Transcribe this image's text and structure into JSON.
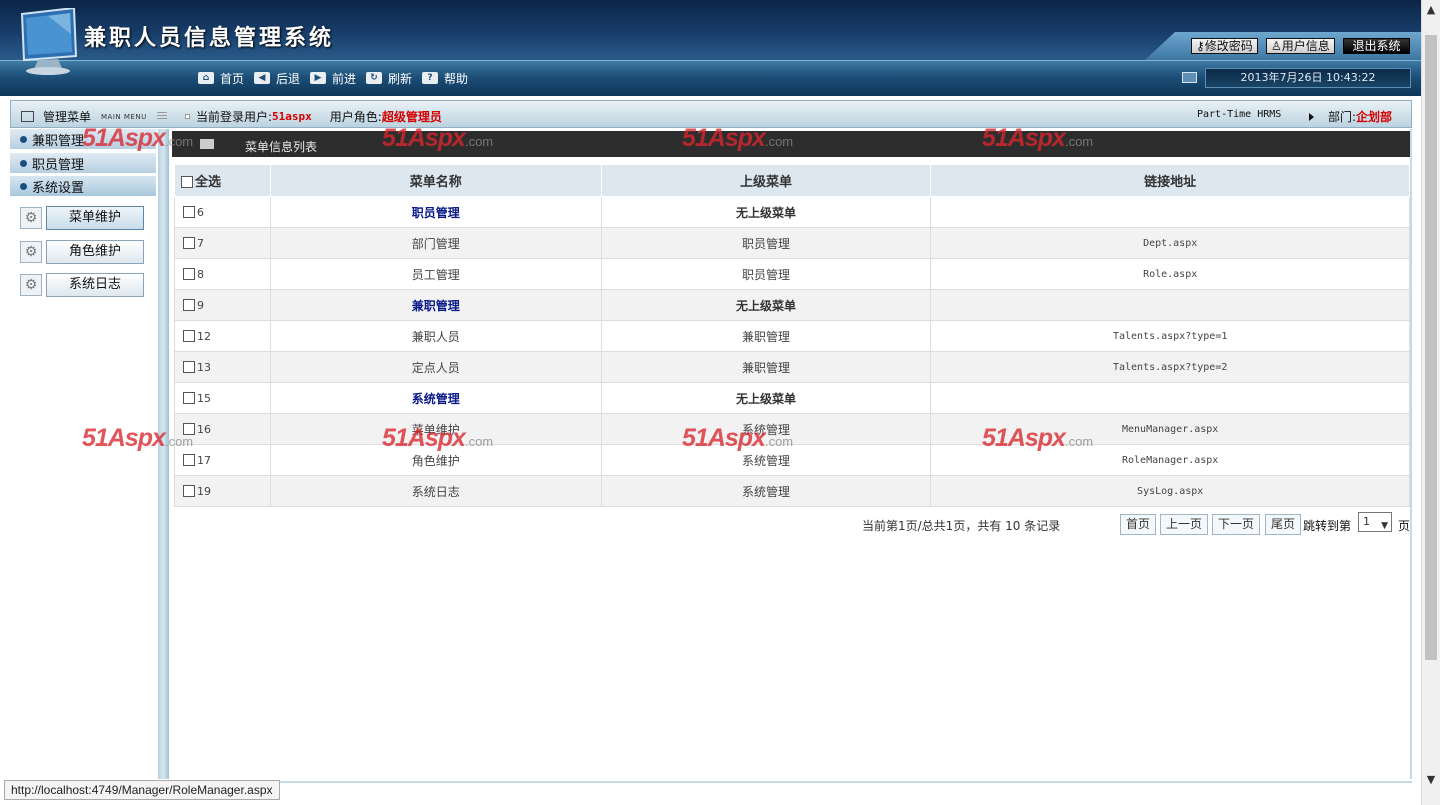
{
  "header": {
    "title": "兼职人员信息管理系统",
    "buttons": {
      "change_password": "修改密码",
      "user_info": "用户信息",
      "logout": "退出系统"
    },
    "nav": {
      "home": "首页",
      "back": "后退",
      "forward": "前进",
      "refresh": "刷新",
      "help": "帮助"
    },
    "datetime": "2013年7月26日 10:43:22"
  },
  "infobar": {
    "menu_title": "管理菜单",
    "menu_title_en": "MAIN MENU",
    "current_user_label": "当前登录用户:",
    "current_user": "51aspx",
    "role_label": "用户角色:",
    "role": "超级管理员",
    "system_en": "Part-Time HRMS",
    "dept_label": "部门:",
    "dept": "企划部"
  },
  "sidebar": {
    "groups": [
      "兼职管理",
      "职员管理",
      "系统设置"
    ],
    "sub_items": [
      "菜单维护",
      "角色维护",
      "系统日志"
    ]
  },
  "content": {
    "list_title": "菜单信息列表",
    "columns": {
      "select_all": "全选",
      "name": "菜单名称",
      "parent": "上级菜单",
      "url": "链接地址"
    },
    "rows": [
      {
        "id": "6",
        "name": "职员管理",
        "parent": "无上级菜单",
        "url": ""
      },
      {
        "id": "7",
        "name": "部门管理",
        "parent": "职员管理",
        "url": "Dept.aspx"
      },
      {
        "id": "8",
        "name": "员工管理",
        "parent": "职员管理",
        "url": "Role.aspx"
      },
      {
        "id": "9",
        "name": "兼职管理",
        "parent": "无上级菜单",
        "url": ""
      },
      {
        "id": "12",
        "name": "兼职人员",
        "parent": "兼职管理",
        "url": "Talents.aspx?type=1"
      },
      {
        "id": "13",
        "name": "定点人员",
        "parent": "兼职管理",
        "url": "Talents.aspx?type=2"
      },
      {
        "id": "15",
        "name": "系统管理",
        "parent": "无上级菜单",
        "url": ""
      },
      {
        "id": "16",
        "name": "菜单维护",
        "parent": "系统管理",
        "url": "MenuManager.aspx"
      },
      {
        "id": "17",
        "name": "角色维护",
        "parent": "系统管理",
        "url": "RoleManager.aspx"
      },
      {
        "id": "19",
        "name": "系统日志",
        "parent": "系统管理",
        "url": "SysLog.aspx"
      }
    ],
    "pager": {
      "info": "当前第1页/总共1页，共有 10 条记录",
      "first": "首页",
      "prev": "上一页",
      "next": "下一页",
      "last": "尾页",
      "jump_label": "跳转到第",
      "page_value": "1",
      "page_unit": "页"
    }
  },
  "watermark": {
    "main": "51Aspx",
    "suffix": ".com"
  },
  "status_url": "http://localhost:4749/Manager/RoleManager.aspx",
  "colors": {
    "header_dark": "#0e2a4e",
    "accent_red": "#d40000",
    "top_menu_blue": "#0a1a8a"
  }
}
